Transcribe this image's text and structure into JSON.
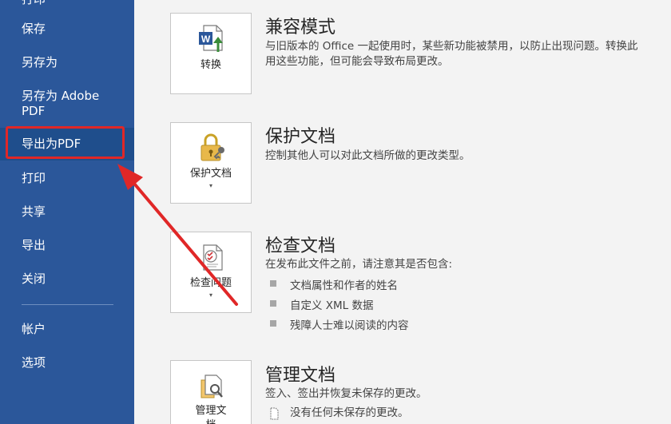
{
  "sidebar": {
    "top_partial": "打印",
    "items": [
      {
        "label": "保存"
      },
      {
        "label": "另存为"
      },
      {
        "label": "另存为 Adobe PDF"
      },
      {
        "label": "导出为PDF"
      },
      {
        "label": "打印"
      },
      {
        "label": "共享"
      },
      {
        "label": "导出"
      },
      {
        "label": "关闭"
      },
      {
        "label": "帐户"
      },
      {
        "label": "选项"
      }
    ],
    "accent": "#2b579a",
    "highlight_color": "#e02727"
  },
  "sections": [
    {
      "tile_label": "转换",
      "title": "兼容模式",
      "desc_line1": "与旧版本的 Office 一起使用时，某些新功能被禁用，以防止出现问题。转换此",
      "desc_line2": "用这些功能，但可能会导致布局更改。",
      "icon": "word-convert-icon"
    },
    {
      "tile_label": "保护文档",
      "title": "保护文档",
      "desc_line1": "控制其他人可以对此文档所做的更改类型。",
      "icon": "lock-key-icon"
    },
    {
      "tile_label": "检查问题",
      "title": "检查文档",
      "desc_line1": "在发布此文件之前，请注意其是否包含:",
      "bullets": [
        "文档属性和作者的姓名",
        "自定义 XML 数据",
        "残障人士难以阅读的内容"
      ],
      "icon": "inspect-checklist-icon"
    },
    {
      "tile_label_line1": "管理文",
      "tile_label_line2": "档",
      "title": "管理文档",
      "desc_line1": "签入、签出并恢复未保存的更改。",
      "desc_line2": "没有任何未保存的更改。",
      "icon": "manage-document-icon"
    }
  ]
}
